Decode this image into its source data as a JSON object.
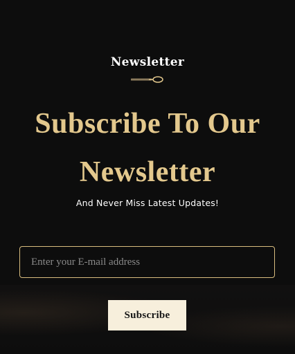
{
  "newsletter": {
    "eyebrow": "Newsletter",
    "divider_icon": "spoon-icon",
    "heading_line1": "Subscribe To Our",
    "heading_line2": "Newsletter",
    "subheading": "And Never Miss Latest Updates!",
    "email_placeholder": "Enter your E-mail address",
    "email_value": "",
    "subscribe_label": "Subscribe"
  },
  "colors": {
    "background": "#0d0d0d",
    "accent_gold": "#e3c88d",
    "border_gold": "#d9bd7f",
    "button_bg": "#f7efdc",
    "button_text": "#151515",
    "text_white": "#ffffff"
  }
}
